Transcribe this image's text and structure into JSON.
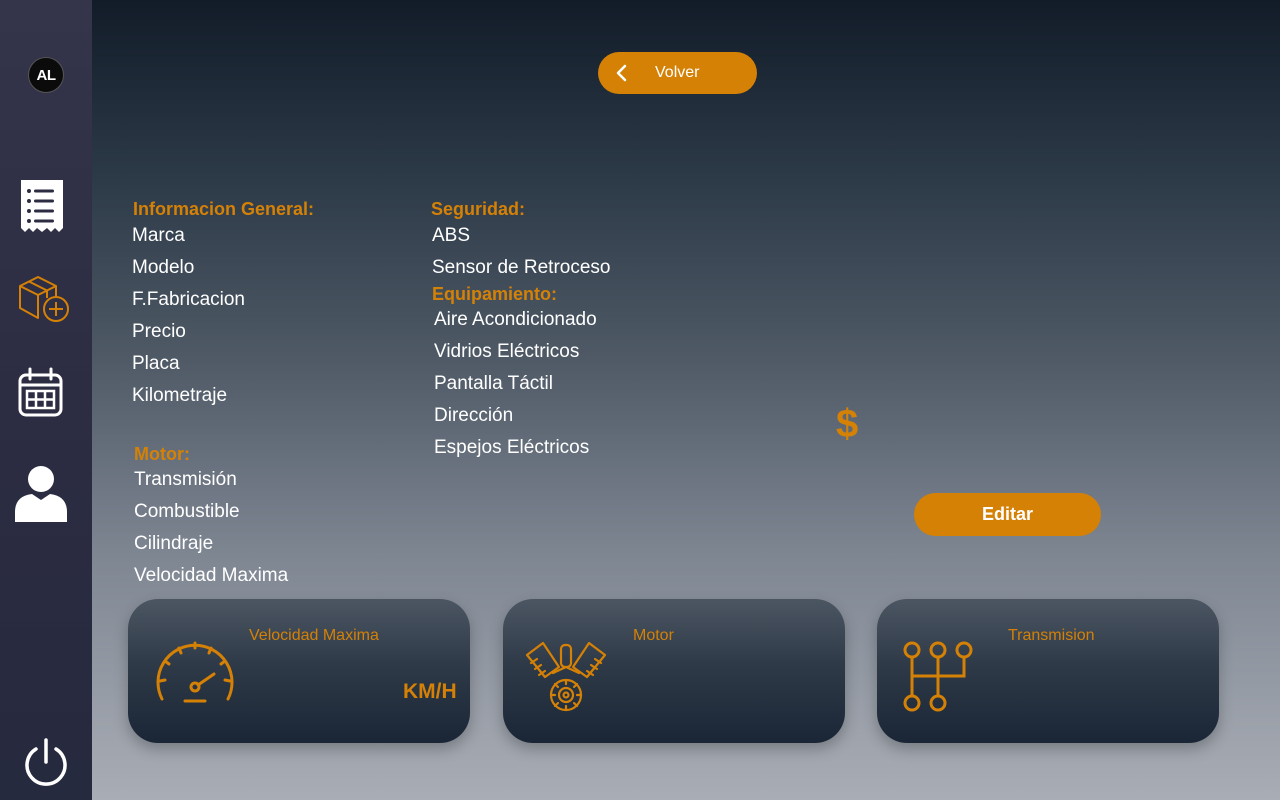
{
  "sidebar": {
    "logo_text": "AL",
    "items": [
      {
        "icon": "document-list-icon"
      },
      {
        "icon": "add-package-icon"
      },
      {
        "icon": "calendar-icon"
      },
      {
        "icon": "user-icon"
      },
      {
        "icon": "power-icon"
      }
    ]
  },
  "header": {
    "back_label": "Volver"
  },
  "general": {
    "title": "Informacion General:",
    "items": [
      "Marca",
      "Modelo",
      "F.Fabricacion",
      "Precio",
      "Placa",
      "Kilometraje"
    ]
  },
  "motor": {
    "title": "Motor:",
    "items": [
      "Transmisión",
      "Combustible",
      "Cilindraje",
      "Velocidad Maxima"
    ]
  },
  "seguridad": {
    "title": "Seguridad:",
    "items": [
      "ABS",
      "Sensor de Retroceso"
    ]
  },
  "equipamiento": {
    "title": "Equipamiento:",
    "items": [
      "Aire Acondicionado",
      "Vidrios Eléctricos",
      "Pantalla Táctil",
      "Dirección",
      "Espejos Eléctricos"
    ]
  },
  "price": {
    "symbol": "$"
  },
  "actions": {
    "edit_label": "Editar"
  },
  "cards": [
    {
      "title": "Velocidad Maxima",
      "unit": "KM/H",
      "icon": "speedometer-icon"
    },
    {
      "title": "Motor",
      "icon": "engine-icon"
    },
    {
      "title": "Transmision",
      "icon": "gear-shift-icon"
    }
  ],
  "colors": {
    "accent": "#d48106",
    "sidebar": "#2c2c42",
    "text": "#ffffff"
  }
}
